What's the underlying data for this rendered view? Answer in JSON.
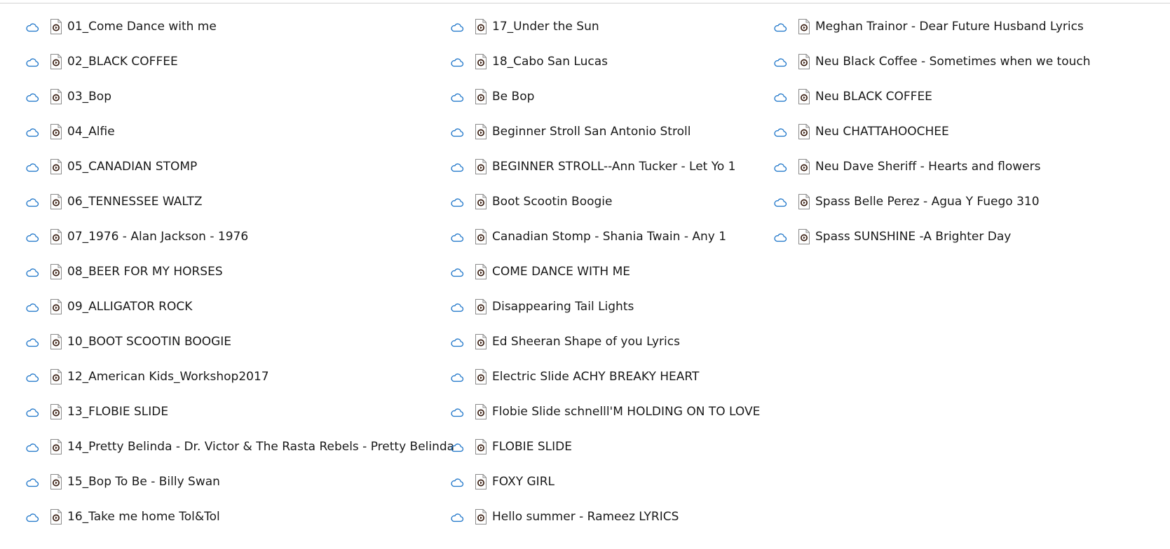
{
  "colors": {
    "cloud_icon": "#1a73c8",
    "file_icon_border": "#8a8a8a",
    "file_icon_badge": "#3a1f12",
    "text": "#1a1a1a",
    "top_border": "#d4d4d4"
  },
  "icons": {
    "status": "cloud-icon",
    "file": "media-file-icon"
  },
  "columns": [
    {
      "files": [
        "01_Come Dance with me",
        "02_BLACK COFFEE",
        "03_Bop",
        "04_Alfie",
        "05_CANADIAN STOMP",
        "06_TENNESSEE WALTZ",
        "07_1976 - Alan Jackson - 1976",
        "08_BEER FOR MY HORSES",
        "09_ALLIGATOR ROCK",
        "10_BOOT SCOOTIN BOOGIE",
        "12_American Kids_Workshop2017",
        "13_FLOBIE SLIDE",
        "14_Pretty Belinda - Dr. Victor & The Rasta Rebels - Pretty Belinda",
        "15_Bop To Be - Billy Swan",
        "16_Take me home  Tol&Tol"
      ]
    },
    {
      "files": [
        "17_Under the Sun",
        "18_Cabo San Lucas",
        "Be Bop",
        "Beginner Stroll San Antonio Stroll",
        "BEGINNER STROLL--Ann Tucker - Let Yo 1",
        "Boot Scootin Boogie",
        "Canadian Stomp - Shania Twain - Any 1",
        "COME DANCE WITH ME",
        "Disappearing Tail Lights",
        "Ed Sheeran Shape of you Lyrics",
        "Electric Slide ACHY BREAKY HEART",
        "Flobie Slide schnelll'M HOLDING ON TO LOVE",
        "FLOBIE SLIDE",
        "FOXY GIRL",
        "Hello summer - Rameez LYRICS"
      ]
    },
    {
      "files": [
        "Meghan Trainor - Dear Future Husband Lyrics",
        "Neu Black Coffee - Sometimes when we touch",
        "Neu BLACK COFFEE",
        "Neu CHATTAHOOCHEE",
        "Neu Dave Sheriff - Hearts and flowers",
        "Spass Belle Perez - Agua Y Fuego 310",
        "Spass SUNSHINE -A Brighter Day"
      ]
    }
  ]
}
